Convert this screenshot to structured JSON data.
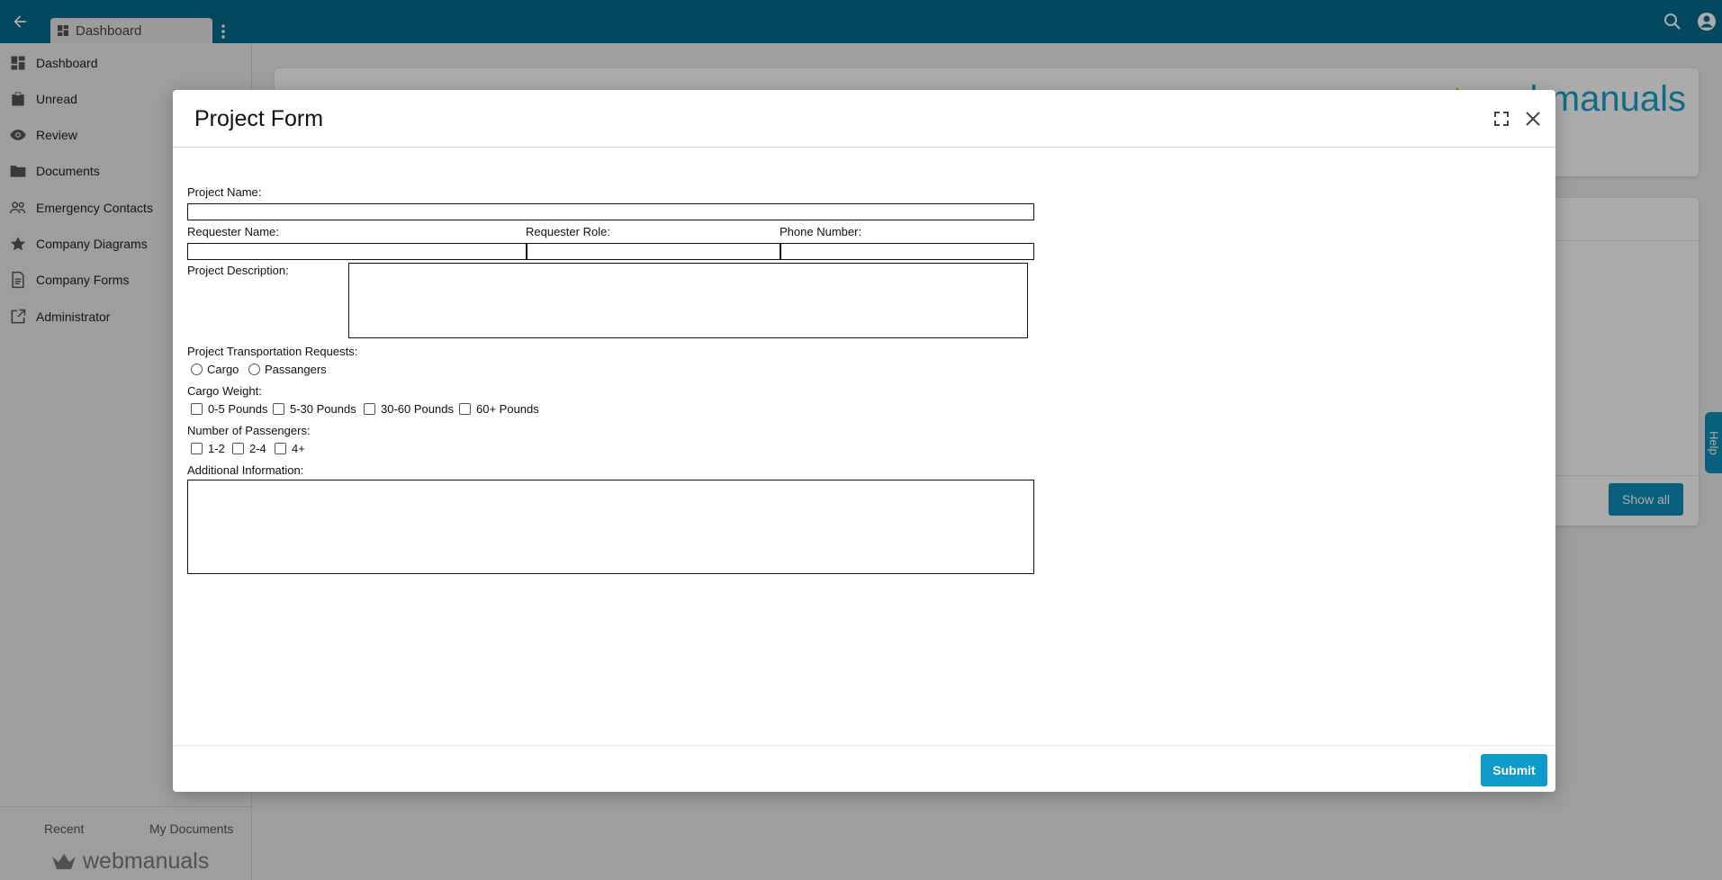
{
  "topbar": {
    "tab_label": "Dashboard"
  },
  "sidebar": {
    "items": [
      {
        "label": "Dashboard",
        "icon": "dashboard-icon"
      },
      {
        "label": "Unread",
        "icon": "unread-icon"
      },
      {
        "label": "Review",
        "icon": "eye-icon"
      },
      {
        "label": "Documents",
        "icon": "folder-icon"
      },
      {
        "label": "Emergency Contacts",
        "icon": "contacts-icon"
      },
      {
        "label": "Company Diagrams",
        "icon": "star-icon"
      },
      {
        "label": "Company Forms",
        "icon": "form-icon"
      },
      {
        "label": "Administrator",
        "icon": "external-edit-icon"
      }
    ],
    "footer": {
      "recent": "Recent",
      "my_documents": "My Documents",
      "brand": "webmanuals"
    }
  },
  "background": {
    "logo_text": "webmanuals",
    "show_all": "Show all",
    "help": "Help"
  },
  "modal": {
    "title": "Project Form",
    "submit": "Submit",
    "form": {
      "project_name": "Project Name:",
      "requester_name": "Requester Name:",
      "requester_role": "Requester Role:",
      "phone_number": "Phone Number:",
      "project_description": "Project Description:",
      "transport_requests": "Project Transportation Requests:",
      "transport_options": [
        "Cargo",
        "Passangers"
      ],
      "cargo_weight": "Cargo Weight:",
      "cargo_options": [
        "0-5 Pounds",
        "5-30 Pounds",
        "30-60 Pounds",
        "60+ Pounds"
      ],
      "passengers": "Number of Passengers:",
      "passenger_options": [
        "1-2",
        "2-4",
        "4+"
      ],
      "additional_info": "Additional Information:"
    }
  },
  "colors": {
    "topbar": "#086d8f",
    "accent": "#0e9bcc",
    "brand_blue": "#1aa0c8",
    "brand_gold": "#f2c200"
  }
}
